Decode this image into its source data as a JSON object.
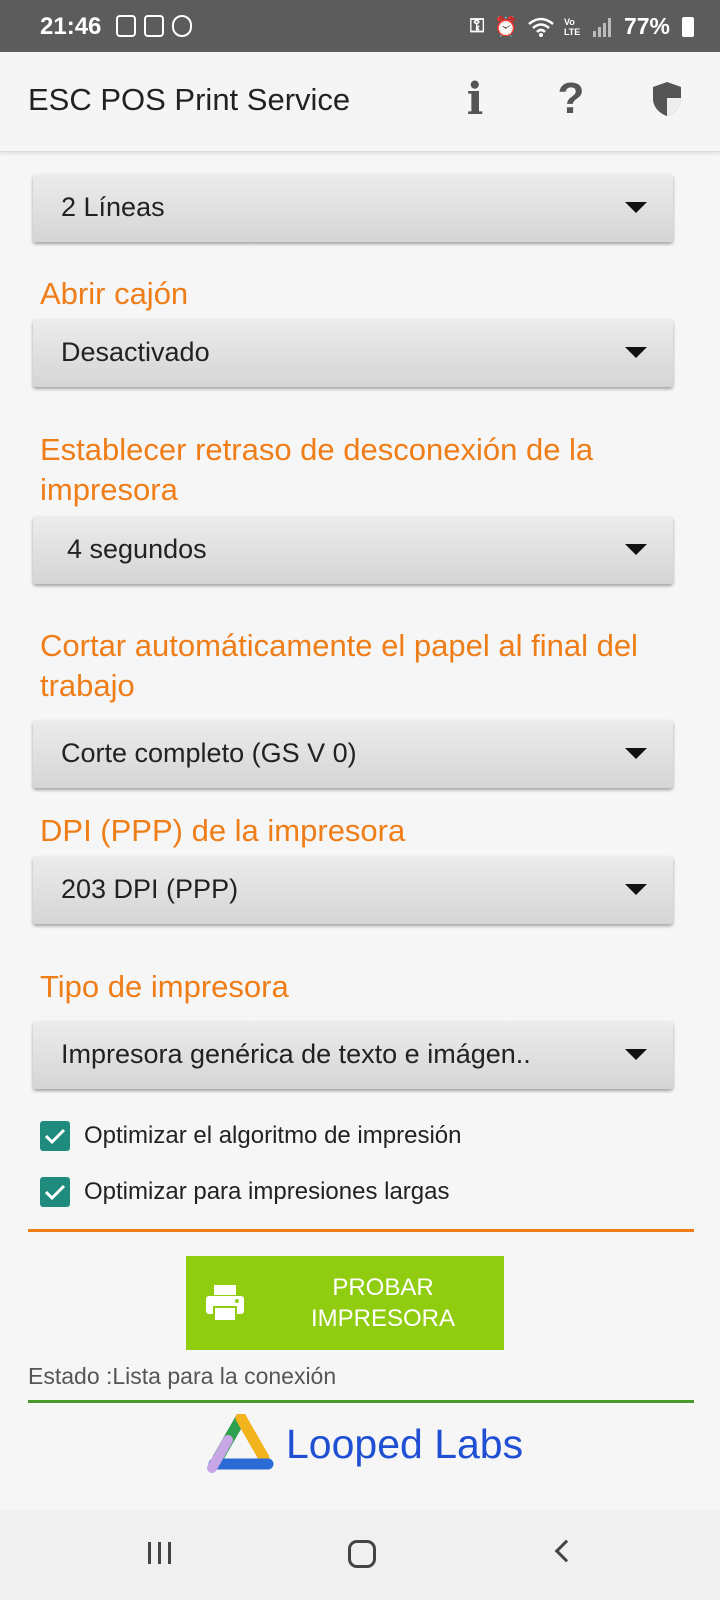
{
  "status_bar": {
    "time": "21:46",
    "battery": "77%",
    "icons": [
      "gallery-icon",
      "screen-recorder-icon",
      "app-icon",
      "vpn-key-icon",
      "alarm-icon",
      "wifi-icon",
      "volte-icon",
      "signal-icon",
      "battery-icon"
    ],
    "volte_label": "Vo LTE"
  },
  "app_bar": {
    "title": "ESC POS Print Service",
    "info_glyph": "i",
    "help_glyph": "?",
    "actions": [
      "info-icon",
      "help-icon",
      "shield-icon"
    ]
  },
  "settings": {
    "line_feed": {
      "value": "2 Líneas"
    },
    "open_drawer": {
      "label": "Abrir cajón",
      "value": "Desactivado"
    },
    "disconnect_delay": {
      "label": "Establecer retraso de desconexión de la impresora",
      "value": "4 segundos"
    },
    "auto_cut": {
      "label": "Cortar automáticamente el papel al final del trabajo",
      "value": "Corte completo (GS V 0)"
    },
    "printer_dpi": {
      "label": "DPI (PPP) de la impresora",
      "value": "203 DPI (PPP)"
    },
    "printer_type": {
      "label": "Tipo de impresora",
      "value": "Impresora genérica de texto e imágen.."
    },
    "optimize_algorithm": {
      "label": "Optimizar el algoritmo de impresión",
      "checked": true
    },
    "optimize_long": {
      "label": "Optimizar para impresiones largas",
      "checked": true
    }
  },
  "test_button": {
    "label_line1": "PROBAR",
    "label_line2": "IMPRESORA"
  },
  "status": {
    "text": "Estado :Lista para la conexión"
  },
  "logo": {
    "text": "Looped Labs"
  },
  "colors": {
    "accent": "#ef7d18",
    "button": "#90cc10",
    "checkbox": "#1e8b7c",
    "logo_text": "#1f4fd3",
    "status_bar": "#5c5c5c"
  }
}
